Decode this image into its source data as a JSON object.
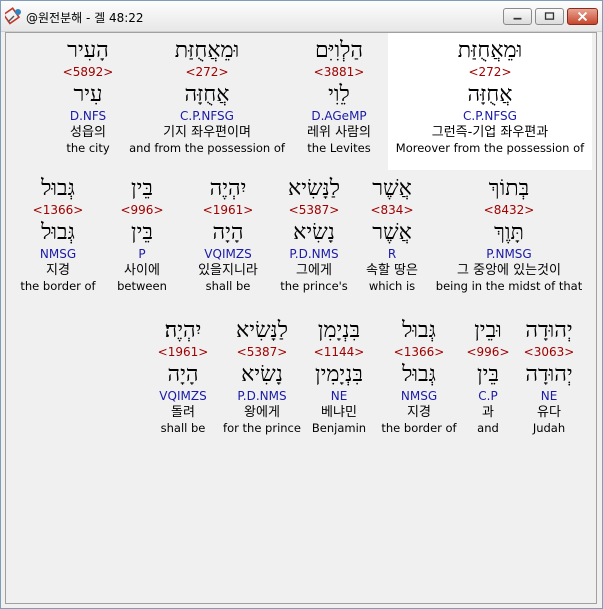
{
  "window": {
    "title": "@원전분해 - 겔 48:22",
    "icon": "app-icon",
    "buttons": [
      "minimize",
      "maximize",
      "close"
    ]
  },
  "rows": [
    {
      "words": [
        {
          "hebrew": "וּמֵאֲחֻזַּת",
          "strong": "<272>",
          "lemma": "אֲחֻזָּה",
          "morph": "C.P.NFSG",
          "korean": "그런즉-기업 좌우편과",
          "english": "Moreover from the possession of",
          "selected": true
        },
        {
          "hebrew": "הַלְוִיִּם",
          "strong": "<3881>",
          "lemma": "לֵוִי",
          "morph": "D.AGeMP",
          "korean": "레위 사람의",
          "english": "the Levites",
          "selected": false
        },
        {
          "hebrew": "וּמֵאֲחֻזַּת",
          "strong": "<272>",
          "lemma": "אֲחֻזָּה",
          "morph": "C.P.NFSG",
          "korean": "기지 좌우편이며",
          "english": "and from the possession of",
          "selected": false
        },
        {
          "hebrew": "הָעִיר",
          "strong": "<5892>",
          "lemma": "עִיר",
          "morph": "D.NFS",
          "korean": "성읍의",
          "english": "the city",
          "selected": false
        }
      ]
    },
    {
      "words": [
        {
          "hebrew": "בְּתוֹךְ",
          "strong": "<8432>",
          "lemma": "תָּוֶךְ",
          "morph": "P.NMSG",
          "korean": "그 중앙에 있는것이",
          "english": "being in the midst of that",
          "selected": false
        },
        {
          "hebrew": "אֲשֶׁר",
          "strong": "<834>",
          "lemma": "אֲשֶׁר",
          "morph": "R",
          "korean": "속할 땅은",
          "english": "which is",
          "selected": false
        },
        {
          "hebrew": "לַנָּשִׂיא",
          "strong": "<5387>",
          "lemma": "נָשִׂיא",
          "morph": "P.D.NMS",
          "korean": "그에게",
          "english": "the prince's",
          "selected": false
        },
        {
          "hebrew": "יִהְיֶה",
          "strong": "<1961>",
          "lemma": "הָיָה",
          "morph": "VQIMZS",
          "korean": "있을지니라",
          "english": "shall be",
          "selected": false
        },
        {
          "hebrew": "בֵּין",
          "strong": "<996>",
          "lemma": "בֵּין",
          "morph": "P",
          "korean": "사이에",
          "english": "between",
          "selected": false
        },
        {
          "hebrew": "גְּבוּל",
          "strong": "<1366>",
          "lemma": "גְּבוּל",
          "morph": "NMSG",
          "korean": "지경",
          "english": "the border of",
          "selected": false
        }
      ]
    },
    {
      "words": [
        {
          "hebrew": "יְהוּדָה",
          "strong": "<3063>",
          "lemma": "יְהוּדָה",
          "morph": "NE",
          "korean": "유다",
          "english": "Judah",
          "selected": false
        },
        {
          "hebrew": "וּבֵין",
          "strong": "<996>",
          "lemma": "בֵּין",
          "morph": "C.P",
          "korean": "과",
          "english": "and",
          "selected": false
        },
        {
          "hebrew": "גְּבוּל",
          "strong": "<1366>",
          "lemma": "גְּבוּל",
          "morph": "NMSG",
          "korean": "지경",
          "english": "the border of",
          "selected": false
        },
        {
          "hebrew": "בִּנְיָמִן",
          "strong": "<1144>",
          "lemma": "בִּנְיָמִין",
          "morph": "NE",
          "korean": "베냐민",
          "english": "Benjamin",
          "selected": false
        },
        {
          "hebrew": "לַנָּשִׂיא",
          "strong": "<5387>",
          "lemma": "נָשִׂיא",
          "morph": "P.D.NMS",
          "korean": "왕에게",
          "english": "for the prince",
          "selected": false
        },
        {
          "hebrew": "יִהְיֶה׃",
          "strong": "<1961>",
          "lemma": "הָיָה",
          "morph": "VQIMZS",
          "korean": "돌려",
          "english": "shall be",
          "selected": false
        }
      ]
    }
  ],
  "colors": {
    "strong": "#a00000",
    "morph": "#1a1aa8",
    "selected_bg": "#ffffff",
    "panel_bg": "#f0f0f0"
  }
}
